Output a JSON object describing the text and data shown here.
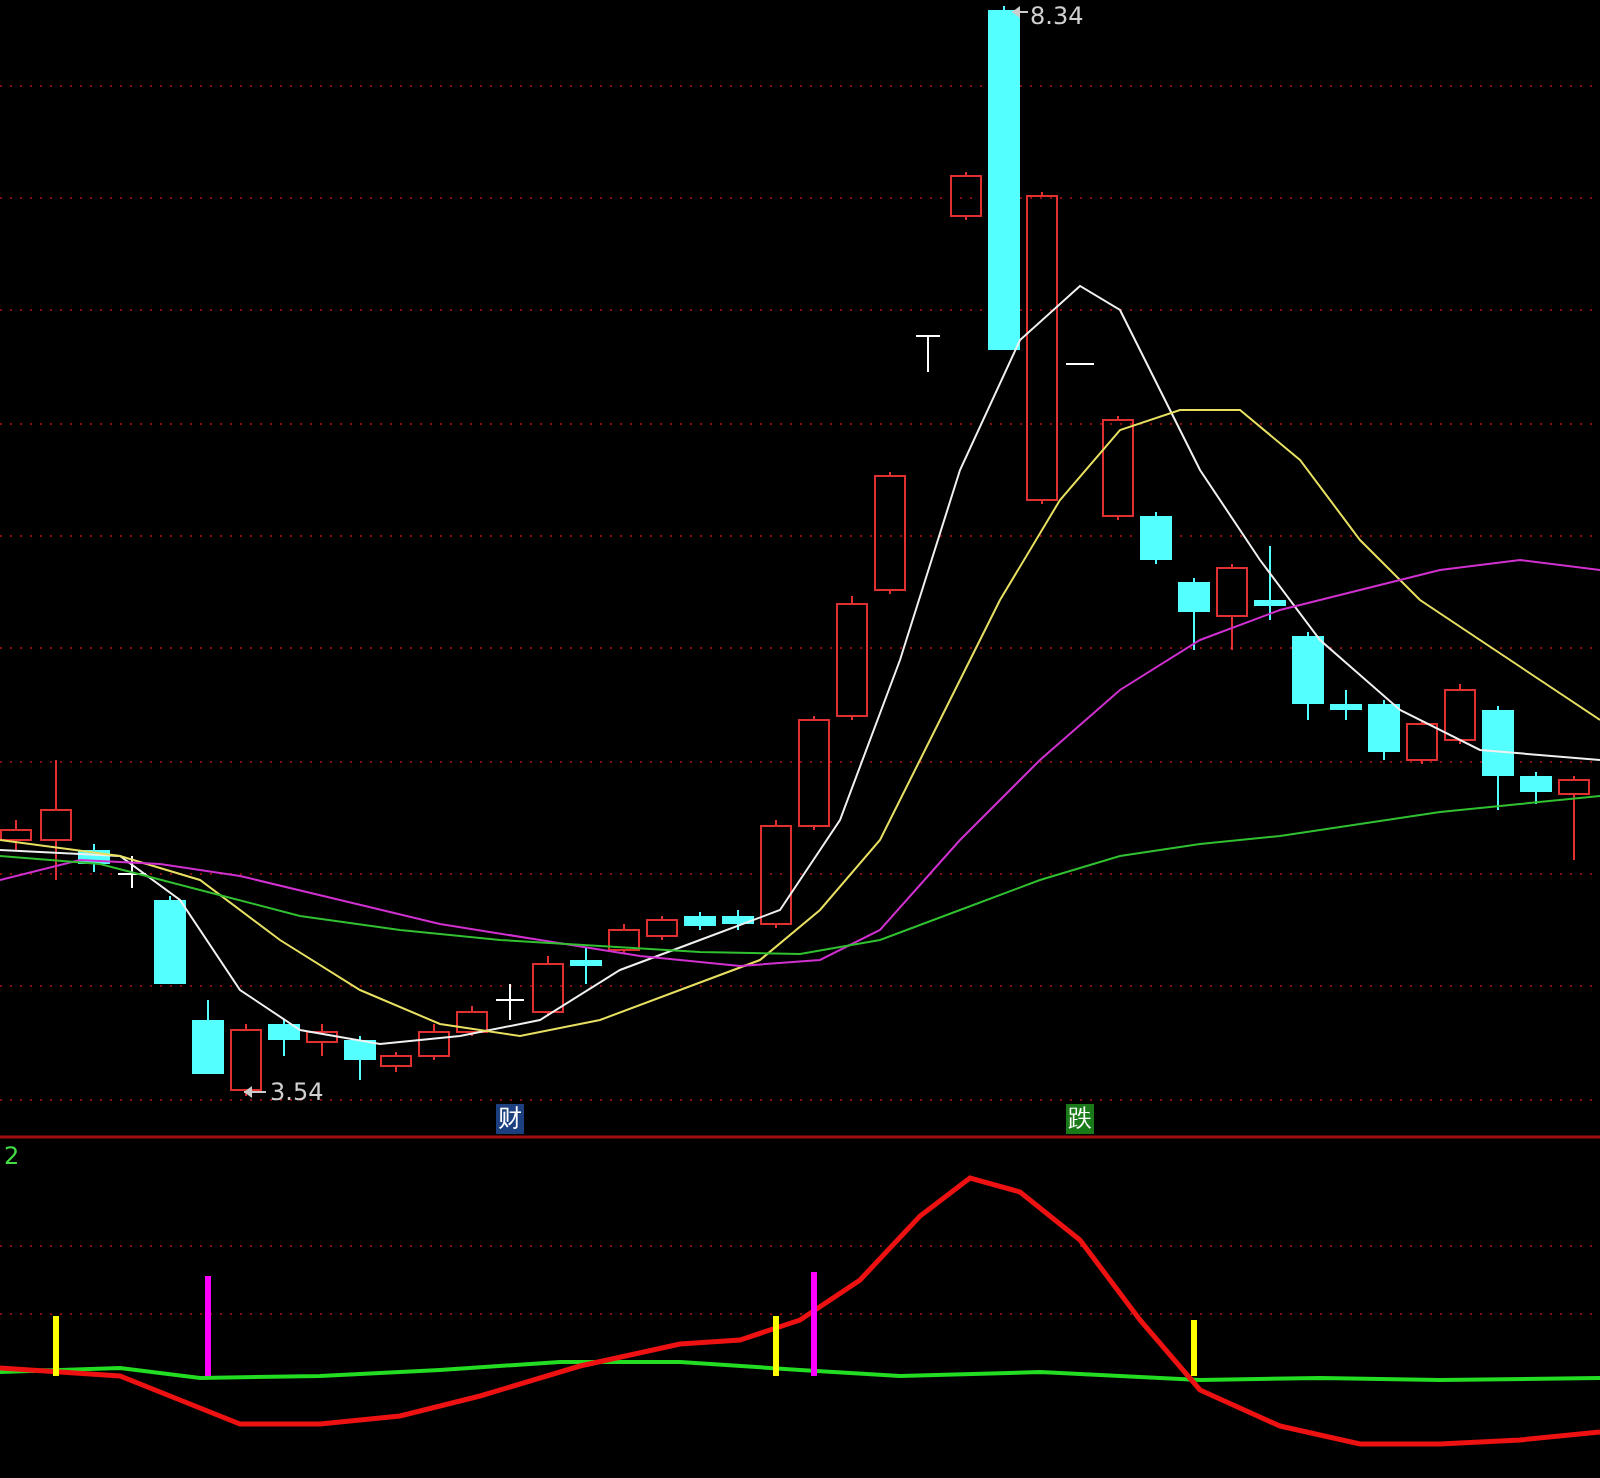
{
  "price_labels": [
    {
      "kind": "high",
      "text": "8.34"
    },
    {
      "kind": "low",
      "text": "3.54"
    }
  ],
  "signals": [
    {
      "text": "财",
      "color": "#1c3f80"
    },
    {
      "text": "跌",
      "color": "#1a7a1a"
    }
  ],
  "indicator_panel": {
    "label": "2"
  }
}
